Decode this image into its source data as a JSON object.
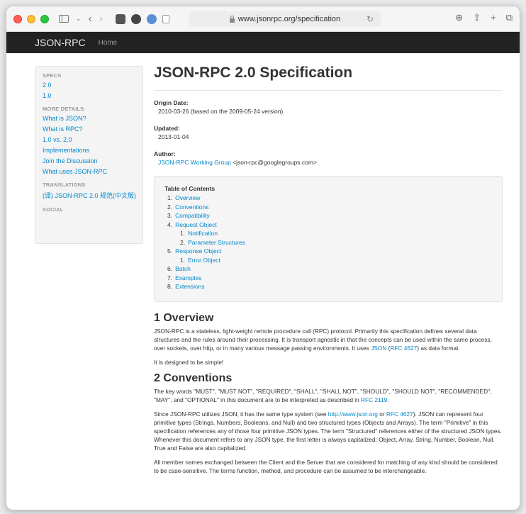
{
  "browser": {
    "url": "www.jsonrpc.org/specification"
  },
  "navbar": {
    "brand": "JSON-RPC",
    "home": "Home"
  },
  "sidebar": {
    "specs_header": "SPECS",
    "specs": [
      "2.0",
      "1.0"
    ],
    "details_header": "MORE DETAILS",
    "details": [
      "What is JSON?",
      "What is RPC?",
      "1.0 vs. 2.0",
      "Implementations",
      "Join the Discussion",
      "What uses JSON-RPC"
    ],
    "translations_header": "TRANSLATIONS",
    "translations": [
      "(译) JSON-RPC 2.0 规范(中文版)"
    ],
    "social_header": "SOCIAL"
  },
  "main": {
    "title": "JSON-RPC 2.0 Specification",
    "origin_label": "Origin Date:",
    "origin_value": "2010-03-26 (based on the 2009-05-24 version)",
    "updated_label": "Updated:",
    "updated_value": "2013-01-04",
    "author_label": "Author:",
    "author_link": "JSON-RPC Working Group",
    "author_email": "<json-rpc@googlegroups.com>",
    "toc": {
      "title": "Table of Contents",
      "items": [
        {
          "num": "1.",
          "label": "Overview",
          "sub": false
        },
        {
          "num": "2.",
          "label": "Conventions",
          "sub": false
        },
        {
          "num": "3.",
          "label": "Compatibility",
          "sub": false
        },
        {
          "num": "4.",
          "label": "Request Object",
          "sub": false
        },
        {
          "num": "1.",
          "label": "Notification",
          "sub": true
        },
        {
          "num": "2.",
          "label": "Parameter Structures",
          "sub": true
        },
        {
          "num": "5.",
          "label": "Response Object",
          "sub": false
        },
        {
          "num": "1.",
          "label": "Error Object",
          "sub": true
        },
        {
          "num": "6.",
          "label": "Batch",
          "sub": false
        },
        {
          "num": "7.",
          "label": "Examples",
          "sub": false
        },
        {
          "num": "8.",
          "label": "Extensions",
          "sub": false
        }
      ]
    },
    "overview": {
      "heading": "1 Overview",
      "p1_text": "JSON-RPC is a stateless, light-weight remote procedure call (RPC) protocol. Primarily this specification defines several data structures and the rules around their processing. It is transport agnostic in that the concepts can be used within the same process, over sockets, over http, or in many various message passing environments. It uses",
      "p1_link1": "JSON",
      "p1_link2": "RFC 4627",
      "p1_end": "data format.",
      "p2": "It is designed to be simple!"
    },
    "conventions": {
      "heading": "2 Conventions",
      "p1_text": "The key words \"MUST\", \"MUST NOT\", \"REQUIRED\", \"SHALL\", \"SHALL NOT\", \"SHOULD\", \"SHOULD NOT\", \"RECOMMENDED\", \"MAY\", and \"OPTIONAL\" in this document are to be interpreted as described in",
      "p1_link": "RFC 2119",
      "p2_start": "Since JSON-RPC utilizes JSON, it has the same type system (see",
      "p2_link1": "http://www.json.org",
      "p2_or": "or",
      "p2_link2": "RFC 4627",
      "p2_rest": "). JSON can represent four primitive types (Strings, Numbers, Booleans, and Null) and two structured types (Objects and Arrays). The term \"Primitive\" in this specification references any of those four primitive JSON types. The term \"Structured\" references either of the structured JSON types. Whenever this document refers to any JSON type, the first letter is always capitalized: Object, Array, String, Number, Boolean, Null. True and False are also capitalized.",
      "p3": "All member names exchanged between the Client and the Server that are considered for matching of any kind should be considered to be case-sensitive. The terms function, method, and procedure can be assumed to be interchangeable."
    }
  }
}
